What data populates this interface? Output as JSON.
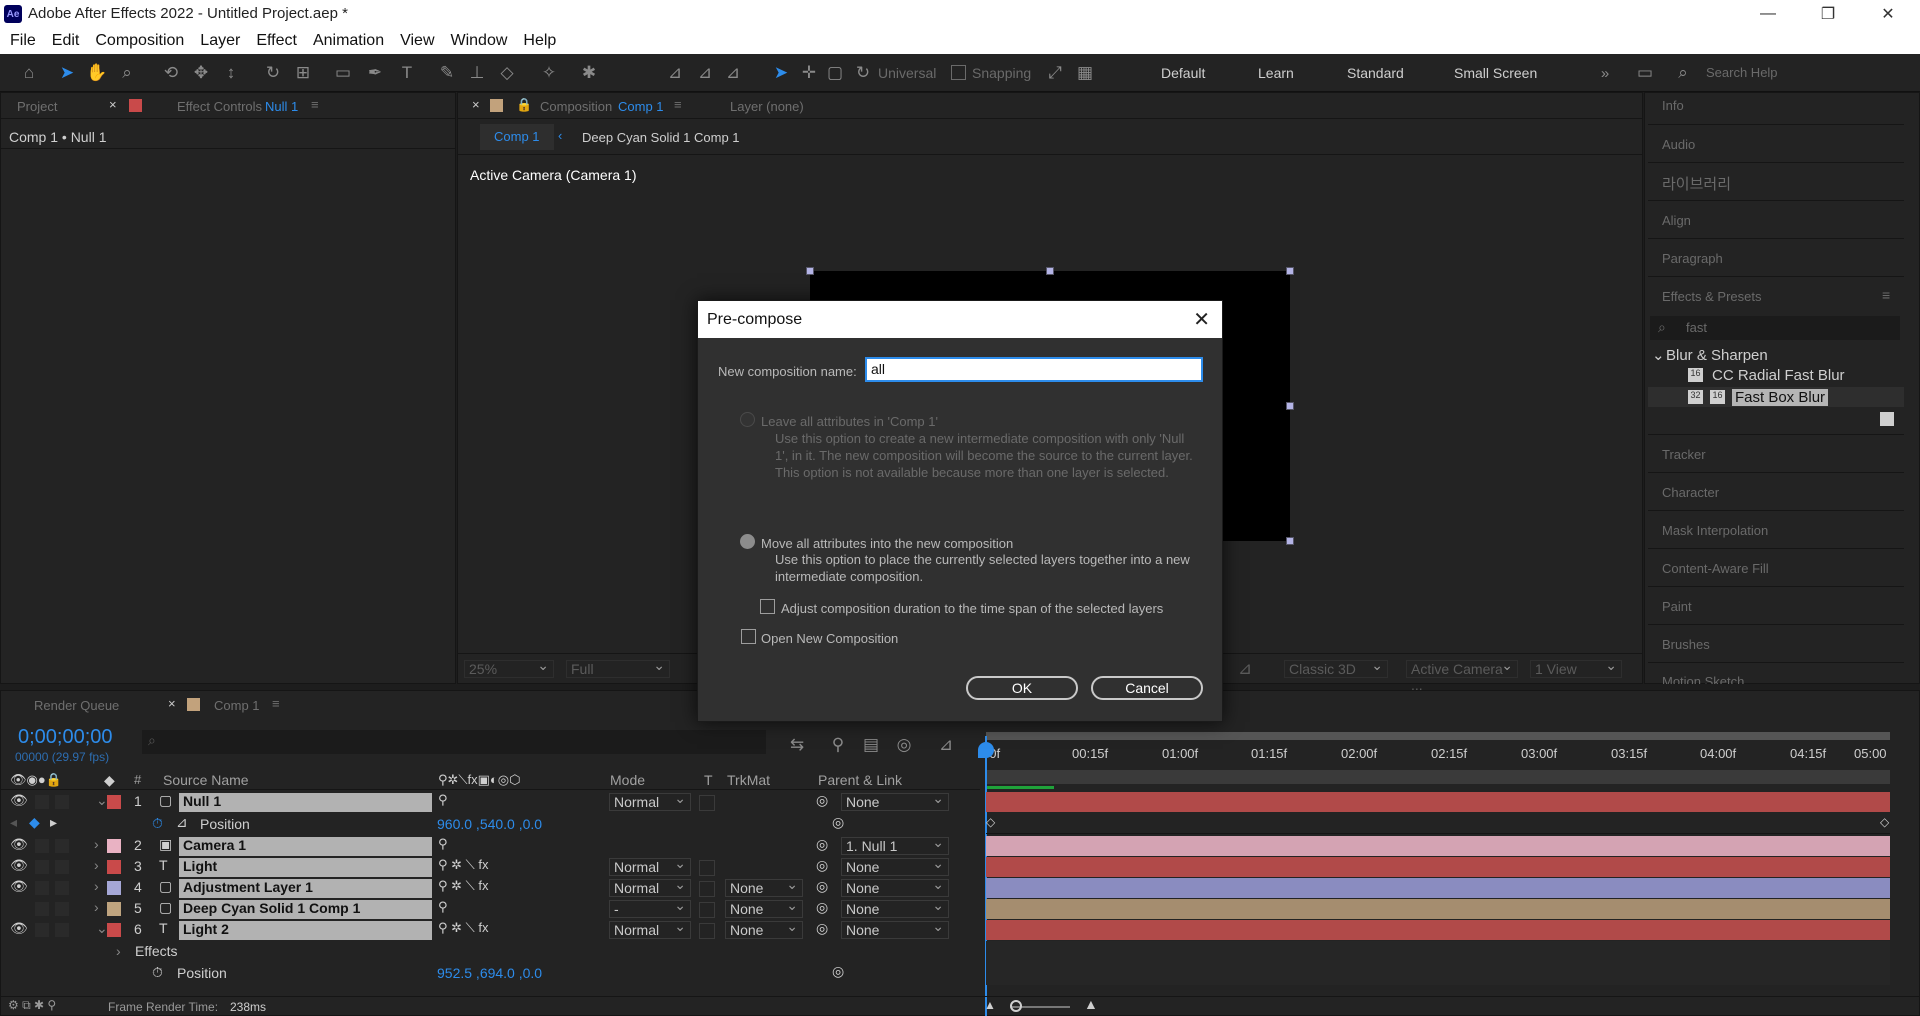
{
  "window": {
    "title": "Adobe After Effects 2022 - Untitled Project.aep *",
    "app_icon": "Ae"
  },
  "menu": [
    "File",
    "Edit",
    "Composition",
    "Layer",
    "Effect",
    "Animation",
    "View",
    "Window",
    "Help"
  ],
  "toolbar": {
    "universal_label": "Universal",
    "snapping_label": "Snapping",
    "workspaces": [
      "Default",
      "Learn",
      "Standard",
      "Small Screen"
    ],
    "search_placeholder": "Search Help"
  },
  "left_panel": {
    "tab_project": "Project",
    "tab_effect_controls": "Effect Controls",
    "effect_controls_target": "Null 1",
    "breadcrumb": "Comp 1 • Null 1"
  },
  "comp_panel": {
    "tab_composition": "Composition",
    "comp_name": "Comp 1",
    "layer_tab": "Layer (none)",
    "nav_comp": "Comp 1",
    "nav_sub": "Deep Cyan Solid 1 Comp 1",
    "active_camera": "Active Camera (Camera 1)",
    "bottom": {
      "zoom": "25%",
      "resolution": "Full",
      "renderer": "Classic 3D",
      "camera": "Active Camera ...",
      "views": "1 View"
    }
  },
  "right_panel": {
    "items_top": [
      "Info",
      "Audio",
      "라이브러리",
      "Align",
      "Paragraph"
    ],
    "effects_presets": "Effects & Presets",
    "search_value": "fast",
    "category": "Blur & Sharpen",
    "effects": [
      "CC Radial Fast Blur",
      "Fast Box Blur"
    ],
    "items_bottom": [
      "Tracker",
      "Character",
      "Mask Interpolation",
      "Content-Aware Fill",
      "Paint",
      "Brushes",
      "Motion Sketch"
    ]
  },
  "timeline": {
    "tab_render_queue": "Render Queue",
    "tab_comp": "Comp 1",
    "timecode": "0;00;00;00",
    "frames": "00000 (29.97 fps)",
    "headers": {
      "num": "#",
      "source": "Source Name",
      "mode": "Mode",
      "t": "T",
      "trkmat": "TrkMat",
      "parent": "Parent & Link"
    },
    "ruler": [
      "00f",
      "00:15f",
      "01:00f",
      "01:15f",
      "02:00f",
      "02:15f",
      "03:00f",
      "03:15f",
      "04:00f",
      "04:15f",
      "05:00"
    ],
    "layers": [
      {
        "num": "1",
        "name": "Null 1",
        "mode": "Normal",
        "trkmat": "",
        "parent": "None",
        "color": "#c94a4a",
        "bar": "#b14a49"
      },
      {
        "num": "2",
        "name": "Camera 1",
        "mode": "",
        "trkmat": "",
        "parent": "1. Null 1",
        "color": "#e9b2c3",
        "bar": "#d4a3b3"
      },
      {
        "num": "3",
        "name": "Light",
        "mode": "Normal",
        "trkmat": "",
        "parent": "None",
        "color": "#c94a4a",
        "bar": "#b14a49"
      },
      {
        "num": "4",
        "name": "Adjustment Layer 1",
        "mode": "Normal",
        "trkmat": "None",
        "parent": "None",
        "color": "#a5a7d6",
        "bar": "#8a8cc0"
      },
      {
        "num": "5",
        "name": "Deep Cyan Solid 1 Comp 1",
        "mode": "-",
        "trkmat": "None",
        "parent": "None",
        "color": "#bfa47f",
        "bar": "#a58d6f"
      },
      {
        "num": "6",
        "name": "Light 2",
        "mode": "Normal",
        "trkmat": "None",
        "parent": "None",
        "color": "#c94a4a",
        "bar": "#b14a49"
      }
    ],
    "prop_position_1": {
      "label": "Position",
      "value": "960.0 ,540.0 ,0.0"
    },
    "effects_label": "Effects",
    "prop_position_6": {
      "label": "Position",
      "value": "952.5 ,694.0 ,0.0"
    },
    "footer": {
      "label": "Frame Render Time:",
      "value": "238ms"
    }
  },
  "dialog": {
    "title": "Pre-compose",
    "name_label": "New composition name:",
    "name_value": "all",
    "opt1_label": "Leave all attributes in 'Comp 1'",
    "opt1_desc": "Use this option to create a new intermediate composition with only 'Null 1', in it. The new composition will become the source to the current layer. This option is not available because more than one layer is selected.",
    "opt2_label": "Move all attributes into the new composition",
    "opt2_desc": "Use this option to place the currently selected layers together into a new intermediate composition.",
    "adjust_label": "Adjust composition duration to the time span of the selected layers",
    "open_label": "Open New Composition",
    "ok": "OK",
    "cancel": "Cancel"
  },
  "colors": {
    "accent": "#2d8ceb",
    "panel": "#232323",
    "bg": "#1d1d1d"
  }
}
